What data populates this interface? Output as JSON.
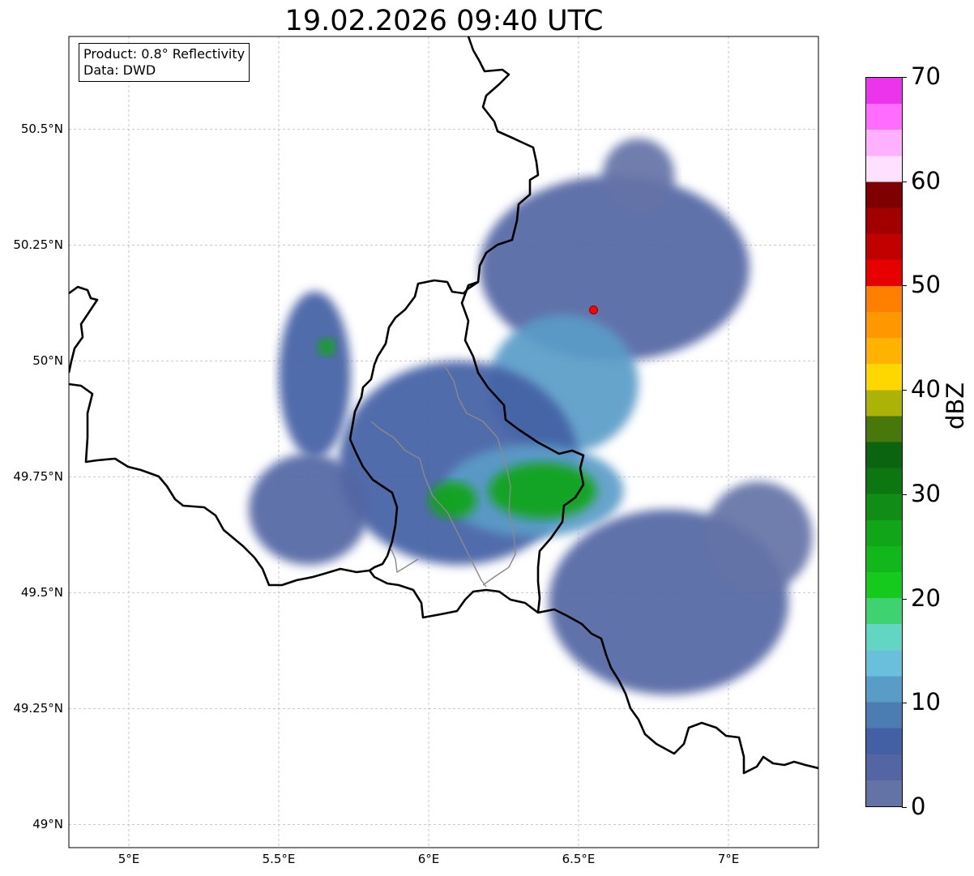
{
  "title": "19.02.2026 09:40 UTC",
  "info": {
    "product": "Product: 0.8° Reflectivity",
    "source": "Data: DWD"
  },
  "map": {
    "lon_range": [
      4.8,
      7.3
    ],
    "lat_range": [
      48.95,
      50.7
    ],
    "lat_ticks": [
      {
        "value": 50.5,
        "label": "50.5°N"
      },
      {
        "value": 50.25,
        "label": "50.25°N"
      },
      {
        "value": 50.0,
        "label": "50°N"
      },
      {
        "value": 49.75,
        "label": "49.75°N"
      },
      {
        "value": 49.5,
        "label": "49.5°N"
      },
      {
        "value": 49.25,
        "label": "49.25°N"
      },
      {
        "value": 49.0,
        "label": "49°N"
      }
    ],
    "lon_ticks": [
      {
        "value": 5.0,
        "label": "5°E"
      },
      {
        "value": 5.5,
        "label": "5.5°E"
      },
      {
        "value": 6.0,
        "label": "6°E"
      },
      {
        "value": 6.5,
        "label": "6.5°E"
      },
      {
        "value": 7.0,
        "label": "7°E"
      }
    ],
    "grid": true,
    "radar_site": {
      "lon": 6.55,
      "lat": 50.11,
      "color": "#ff0000"
    }
  },
  "colorbar": {
    "label": "dBZ",
    "min": 0,
    "max": 70,
    "ticks": [
      {
        "value": 0,
        "label": "0"
      },
      {
        "value": 10,
        "label": "10"
      },
      {
        "value": 20,
        "label": "20"
      },
      {
        "value": 30,
        "label": "30"
      },
      {
        "value": 40,
        "label": "40"
      },
      {
        "value": 50,
        "label": "50"
      },
      {
        "value": 60,
        "label": "60"
      },
      {
        "value": 70,
        "label": "70"
      }
    ],
    "colors": [
      "#6473a6",
      "#5365a3",
      "#4360a4",
      "#4b7db3",
      "#5a9cc8",
      "#68c0dc",
      "#62d6c3",
      "#3ed370",
      "#15c91d",
      "#12b81b",
      "#11a518",
      "#0f8d15",
      "#0c7711",
      "#0a6410",
      "#48770b",
      "#acb307",
      "#ffd700",
      "#ffb300",
      "#ff9800",
      "#ff7f00",
      "#e60000",
      "#c30000",
      "#a20000",
      "#7f0000",
      "#ffe0ff",
      "#ffb0ff",
      "#ff6cff",
      "#ec34ec"
    ]
  },
  "chart_data": {
    "type": "heatmap",
    "title": "19.02.2026 09:40 UTC",
    "xlabel": "",
    "ylabel": "",
    "xlim": [
      4.8,
      7.3
    ],
    "ylim": [
      48.95,
      50.7
    ],
    "value_label": "dBZ",
    "value_range": [
      0,
      70
    ],
    "echo_regions": [
      {
        "lon": 6.62,
        "lat": 50.2,
        "dlon": 0.45,
        "dlat": 0.2,
        "dbz": 3
      },
      {
        "lon": 6.45,
        "lat": 49.95,
        "dlon": 0.25,
        "dlat": 0.15,
        "dbz": 12
      },
      {
        "lon": 6.1,
        "lat": 49.78,
        "dlon": 0.4,
        "dlat": 0.22,
        "dbz": 5
      },
      {
        "lon": 6.35,
        "lat": 49.72,
        "dlon": 0.3,
        "dlat": 0.1,
        "dbz": 10
      },
      {
        "lon": 6.38,
        "lat": 49.72,
        "dlon": 0.18,
        "dlat": 0.06,
        "dbz": 26
      },
      {
        "lon": 6.08,
        "lat": 49.7,
        "dlon": 0.08,
        "dlat": 0.04,
        "dbz": 27
      },
      {
        "lon": 5.6,
        "lat": 49.68,
        "dlon": 0.2,
        "dlat": 0.12,
        "dbz": 3
      },
      {
        "lon": 5.62,
        "lat": 49.97,
        "dlon": 0.12,
        "dlat": 0.18,
        "dbz": 5
      },
      {
        "lon": 5.66,
        "lat": 50.03,
        "dlon": 0.03,
        "dlat": 0.02,
        "dbz": 27
      },
      {
        "lon": 6.8,
        "lat": 49.48,
        "dlon": 0.4,
        "dlat": 0.2,
        "dbz": 3
      },
      {
        "lon": 7.1,
        "lat": 49.62,
        "dlon": 0.18,
        "dlat": 0.12,
        "dbz": 2
      },
      {
        "lon": 6.7,
        "lat": 50.4,
        "dlon": 0.12,
        "dlat": 0.08,
        "dbz": 2
      }
    ]
  }
}
